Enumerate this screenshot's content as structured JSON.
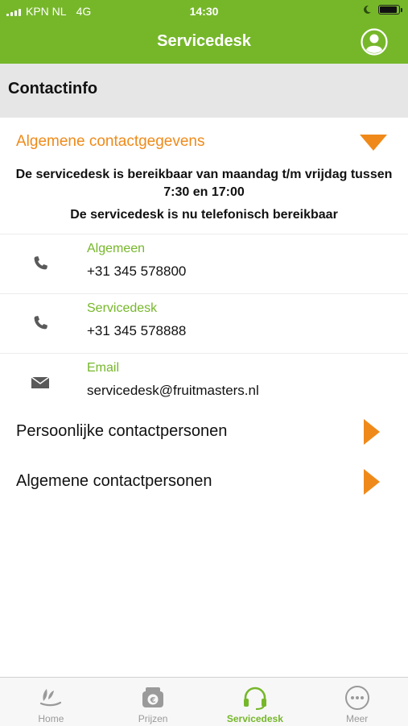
{
  "status_bar": {
    "carrier": "KPN NL",
    "network": "4G",
    "time": "14:30"
  },
  "nav": {
    "title": "Servicedesk",
    "profile_icon": "user-circle-icon"
  },
  "section": {
    "title": "Contactinfo"
  },
  "accordion": {
    "title": "Algemene contactgegevens",
    "hours_line_1": "De servicedesk is bereikbaar van maandag t/m vrijdag tussen",
    "hours_line_2": "7:30 en 17:00",
    "availability": "De servicedesk is nu telefonisch bereikbaar"
  },
  "contacts": [
    {
      "icon": "phone-icon",
      "label": "Algemeen",
      "value": "+31 345 578800"
    },
    {
      "icon": "phone-icon",
      "label": "Servicedesk",
      "value": "+31 345 578888"
    },
    {
      "icon": "mail-icon",
      "label": "Email",
      "value": "servicedesk@fruitmasters.nl"
    }
  ],
  "links": [
    {
      "label": "Persoonlijke contactpersonen"
    },
    {
      "label": "Algemene contactpersonen"
    }
  ],
  "tabs": [
    {
      "label": "Home",
      "icon": "home-leaf-icon",
      "active": false
    },
    {
      "label": "Prijzen",
      "icon": "euro-icon",
      "active": false
    },
    {
      "label": "Servicedesk",
      "icon": "headset-icon",
      "active": true
    },
    {
      "label": "Meer",
      "icon": "more-icon",
      "active": false
    }
  ],
  "colors": {
    "brand_green": "#76b72a",
    "accent_orange": "#ef8a1a",
    "section_bg": "#e6e6e6"
  }
}
